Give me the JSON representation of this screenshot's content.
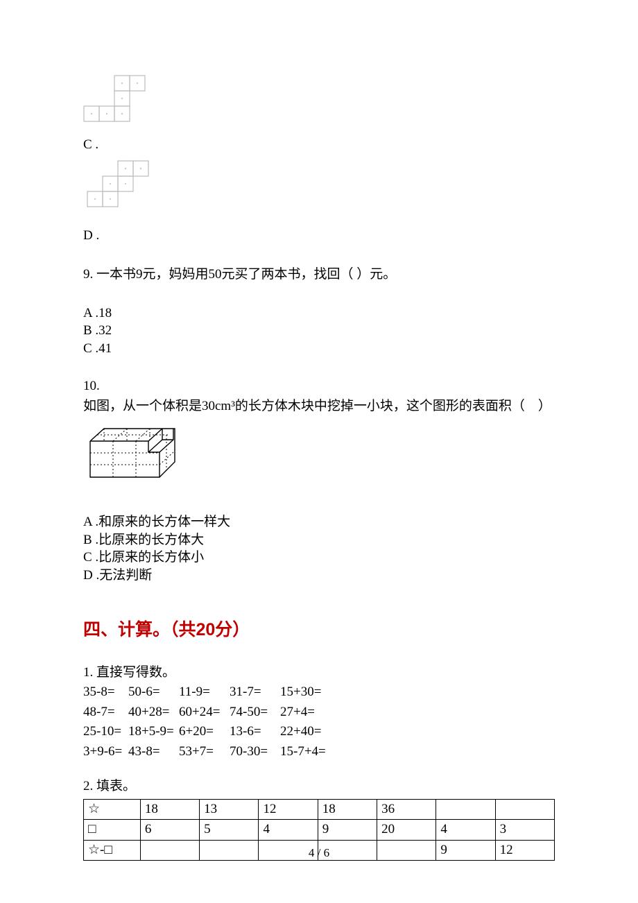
{
  "q8": {
    "optC": {
      "label": "C ."
    },
    "optD": {
      "label": "D ."
    }
  },
  "q9": {
    "text": "9. 一本书9元，妈妈用50元买了两本书，找回（  ）元。",
    "optA": "A .18",
    "optB": "B .32",
    "optC": "C .41"
  },
  "q10": {
    "num": "10.",
    "text": "如图，从一个体积是30cm³的长方体木块中挖掉一小块，这个图形的表面积（　）",
    "optA": "A .和原来的长方体一样大",
    "optB": "B .比原来的长方体大",
    "optC": "C .比原来的长方体小",
    "optD": "D .无法判断"
  },
  "section4": {
    "heading": "四、计算。（共20分）",
    "q1": {
      "title": "1. 直接写得数。",
      "rows": [
        [
          "35-8=",
          "50-6=",
          "11-9=",
          "31-7=",
          "15+30="
        ],
        [
          "48-7=",
          "40+28=",
          "60+24=",
          "74-50=",
          "27+4="
        ],
        [
          "25-10=",
          "18+5-9=",
          "6+20=",
          "13-6=",
          "22+40="
        ],
        [
          "3+9-6=",
          "43-8=",
          "53+7=",
          "70-30=",
          "15-7+4="
        ]
      ]
    },
    "q2": {
      "title": "2. 填表。",
      "table": {
        "header": [
          "☆",
          "18",
          "13",
          "12",
          "18",
          "36",
          "",
          ""
        ],
        "row2": [
          "□",
          "6",
          "5",
          "4",
          "9",
          "20",
          "4",
          "3"
        ],
        "row3": [
          "☆-□",
          "",
          "",
          "",
          "",
          "",
          "9",
          "12"
        ]
      }
    }
  },
  "pagenum": "4 / 6"
}
